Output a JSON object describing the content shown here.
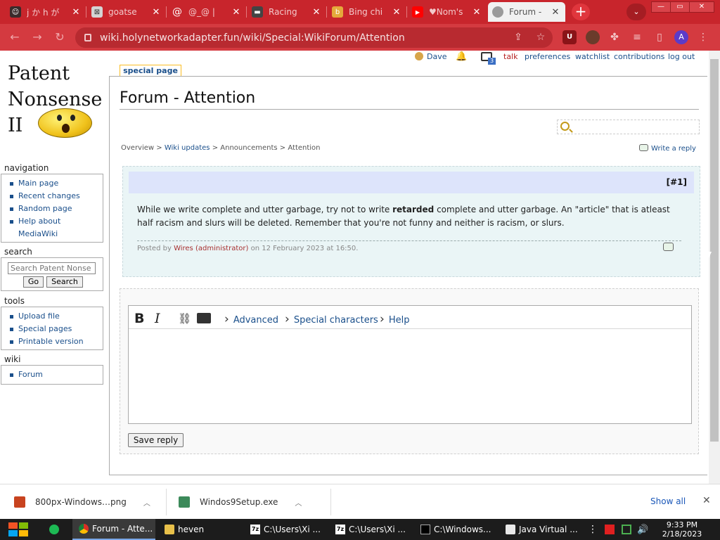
{
  "browser": {
    "tabs": [
      {
        "title": "j か h が",
        "favicon_color": "#3b2b2b"
      },
      {
        "title": "goatse",
        "favicon_color": "#d4d4d4"
      },
      {
        "title": "@_@ |",
        "favicon_color": "#c8252c"
      },
      {
        "title": "Racing",
        "favicon_color": "#444444"
      },
      {
        "title": "Bing chi",
        "favicon_color": "#e5a93b"
      },
      {
        "title": "♥Nom's",
        "favicon_color": "#ff0000"
      },
      {
        "title": "Forum -",
        "favicon_color": "#7a7a7a"
      }
    ],
    "close_glyph": "✕",
    "new_tab": "+",
    "tab_menu": "⌄",
    "window_min": "—",
    "window_restore": "▭",
    "window_close": "✕",
    "url": "wiki.holynetworkadapter.fun/wiki/Special:WikiForum/Attention",
    "profile_initial": "A",
    "ext_badge": "U"
  },
  "wiki": {
    "logo_lines": [
      "Patent",
      "Nonsense",
      "II"
    ],
    "userbar": {
      "user": "Dave",
      "notif_count": "3",
      "talk": "talk",
      "preferences": "preferences",
      "watchlist": "watchlist",
      "contributions": "contributions",
      "logout": "log out"
    },
    "special_tab": "special page",
    "page_title": "Forum - Attention",
    "navigation": {
      "heading": "navigation",
      "items": [
        "Main page",
        "Recent changes",
        "Random page",
        "Help about",
        "MediaWiki"
      ]
    },
    "search": {
      "heading": "search",
      "placeholder": "Search Patent Nonse",
      "go": "Go",
      "search": "Search"
    },
    "tools": {
      "heading": "tools",
      "items": [
        "Upload file",
        "Special pages",
        "Printable version"
      ]
    },
    "wiki_portal": {
      "heading": "wiki",
      "items": [
        "Forum"
      ]
    },
    "breadcrumbs": {
      "overview": "Overview",
      "sep": ">",
      "wiki_updates": "Wiki updates",
      "announcements": "Announcements",
      "attention": "Attention"
    },
    "write_reply": "Write a reply",
    "post": {
      "number": "[#1]",
      "text_before": "While we write complete and utter garbage, try not to write ",
      "text_bold": "retarded",
      "text_after": " complete and utter garbage. An \"article\" that is atleast half racism and slurs will be deleted. Remember that you're not funny and neither is racism, or slurs.",
      "meta_posted_by": "Posted by",
      "meta_author": "Wires",
      "meta_role": "(administrator)",
      "meta_on": "on 12 February 2023 at 16:50."
    },
    "editor": {
      "bold": "B",
      "italic": "I",
      "advanced": "Advanced",
      "special_characters": "Special characters",
      "help": "Help",
      "save_reply": "Save reply"
    }
  },
  "downloads": {
    "items": [
      "800px-Windows…png",
      "Windos9Setup.exe"
    ],
    "show_all": "Show all",
    "close": "✕"
  },
  "taskbar": {
    "items": [
      "Forum - Atte...",
      "heven",
      "C:\\Users\\Xi ...",
      "C:\\Users\\Xi ...",
      "C:\\Windows...",
      "Java Virtual ..."
    ],
    "time": "9:33 PM",
    "date": "2/18/2023"
  }
}
